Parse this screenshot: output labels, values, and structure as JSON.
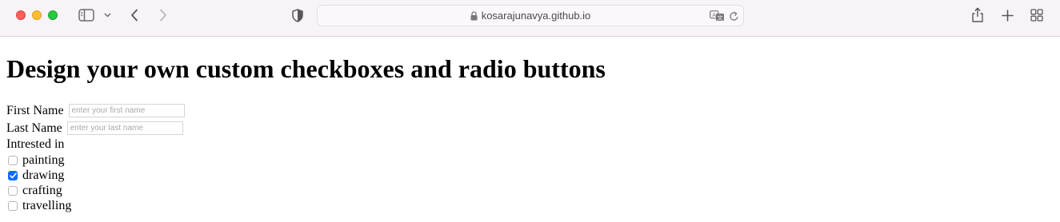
{
  "browser": {
    "url": "kosarajunavya.github.io",
    "icons": {
      "sidebar": "sidebar-icon",
      "chevron": "chevron-down-icon",
      "back": "back-icon",
      "forward": "forward-icon",
      "shield": "shield-icon",
      "lock": "lock-icon",
      "translate": "translate-icon",
      "reload": "reload-icon",
      "share": "share-icon",
      "new_tab": "plus-icon",
      "tabs": "tab-overview-icon"
    }
  },
  "page": {
    "heading": "Design your own custom checkboxes and radio buttons",
    "first_name": {
      "label": "First Name",
      "placeholder": "enter your first name",
      "value": ""
    },
    "last_name": {
      "label": "Last Name",
      "placeholder": "enter your last name",
      "value": ""
    },
    "interests_label": "Intrested in",
    "interests": [
      {
        "label": "painting",
        "checked": false
      },
      {
        "label": "drawing",
        "checked": true
      },
      {
        "label": "crafting",
        "checked": false
      },
      {
        "label": "travelling",
        "checked": false
      }
    ]
  },
  "colors": {
    "checkbox_checked": "#0a6cff",
    "chrome_bg": "#f7f3f7"
  }
}
